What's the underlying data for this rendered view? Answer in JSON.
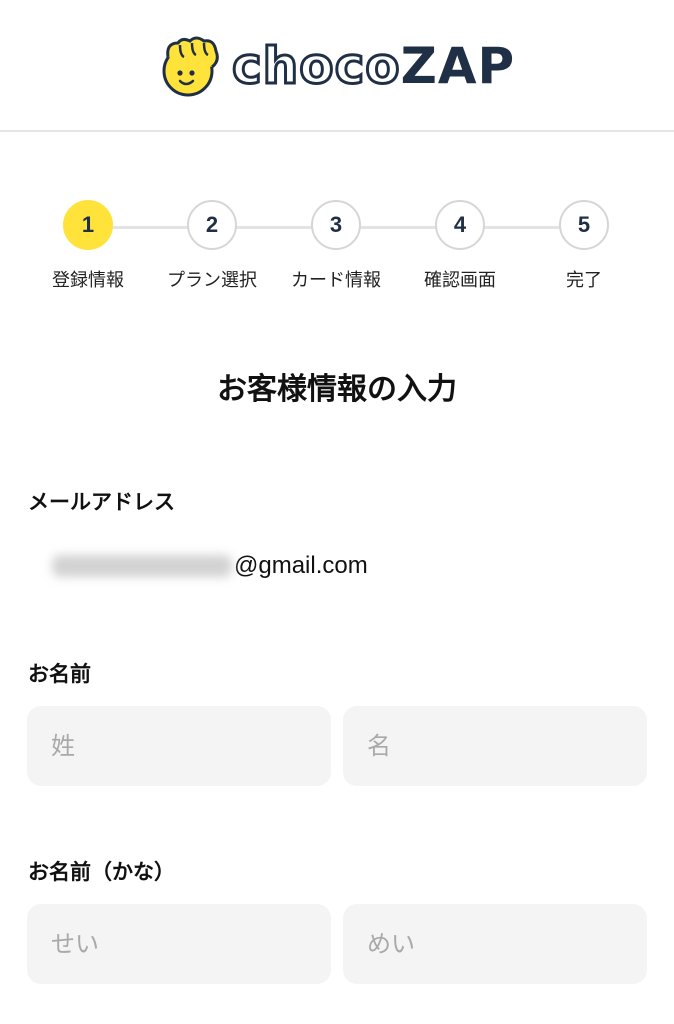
{
  "header": {
    "logo_text_left": "choco",
    "logo_text_right": "ZAP",
    "logo_icon": "fist-bump-mascot-icon",
    "accent_color": "#ffe33b",
    "brand_color": "#1f2f45"
  },
  "stepper": {
    "steps": [
      {
        "number": "1",
        "label": "登録情報",
        "active": true
      },
      {
        "number": "2",
        "label": "プラン選択",
        "active": false
      },
      {
        "number": "3",
        "label": "カード情報",
        "active": false
      },
      {
        "number": "4",
        "label": "確認画面",
        "active": false
      },
      {
        "number": "5",
        "label": "完了",
        "active": false
      }
    ]
  },
  "form": {
    "title": "お客様情報の入力",
    "email": {
      "label": "メールアドレス",
      "value_visible": "@gmail.com"
    },
    "name": {
      "label": "お名前",
      "last_placeholder": "姓",
      "first_placeholder": "名"
    },
    "kana": {
      "label": "お名前（かな）",
      "last_placeholder": "せい",
      "first_placeholder": "めい"
    }
  }
}
